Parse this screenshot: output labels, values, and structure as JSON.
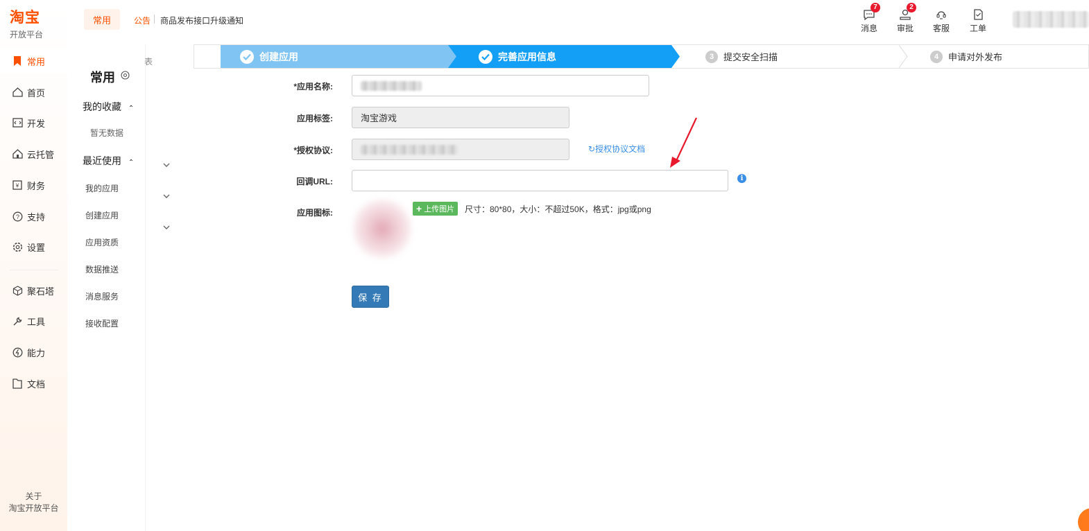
{
  "brand": {
    "logo_text": "淘宝",
    "subtitle": "开放平台"
  },
  "nav": {
    "items": [
      {
        "label": "常用",
        "icon": "bookmark-icon",
        "active": true
      },
      {
        "label": "首页",
        "icon": "home-icon"
      },
      {
        "label": "开发",
        "icon": "code-icon"
      },
      {
        "label": "云托管",
        "icon": "cloud-home-icon"
      },
      {
        "label": "财务",
        "icon": "finance-icon"
      },
      {
        "label": "支持",
        "icon": "help-icon"
      },
      {
        "label": "设置",
        "icon": "gear-icon"
      },
      {
        "label": "聚石塔",
        "icon": "cube-icon"
      },
      {
        "label": "工具",
        "icon": "wrench-icon"
      },
      {
        "label": "能力",
        "icon": "ability-icon"
      },
      {
        "label": "文档",
        "icon": "document-icon"
      }
    ],
    "about_line1": "关于",
    "about_line2": "淘宝开放平台"
  },
  "secondary": {
    "title": "常用",
    "favorites_label": "我的收藏",
    "favorites_empty": "暂无数据",
    "recent_label": "最近使用",
    "recent_items": [
      "我的应用",
      "创建应用",
      "应用资质",
      "数据推送",
      "消息服务",
      "接收配置"
    ],
    "cutoff_text": "表"
  },
  "header": {
    "tab": "常用",
    "notice_label": "公告",
    "notice_text": "商品发布接口升级通知",
    "icons": [
      {
        "label": "消息",
        "badge": "7",
        "icon": "message-icon"
      },
      {
        "label": "审批",
        "badge": "2",
        "icon": "approval-icon"
      },
      {
        "label": "客服",
        "badge": "",
        "icon": "customer-service-icon"
      },
      {
        "label": "工单",
        "badge": "",
        "icon": "ticket-icon"
      }
    ]
  },
  "steps": [
    {
      "label": "创建应用",
      "status": "done"
    },
    {
      "label": "完善应用信息",
      "status": "current"
    },
    {
      "label": "提交安全扫描",
      "num": "3",
      "status": "todo"
    },
    {
      "label": "申请对外发布",
      "num": "4",
      "status": "todo"
    }
  ],
  "form": {
    "app_name_label": "*应用名称:",
    "app_tag_label": "应用标签:",
    "app_tag_value": "淘宝游戏",
    "auth_label": "*授权协议:",
    "auth_doc_link": "授权协议文档",
    "callback_label": "回调URL:",
    "callback_value": "",
    "icon_label": "应用图标:",
    "upload_label": "上传图片",
    "upload_hint": "尺寸：80*80，大小：不超过50K，格式：jpg或png",
    "save_label": "保 存"
  },
  "colors": {
    "brand": "#ff5000",
    "step_done": "#7fc4f3",
    "step_current": "#129ff5",
    "save": "#337ab7",
    "upload": "#5cb85c"
  }
}
